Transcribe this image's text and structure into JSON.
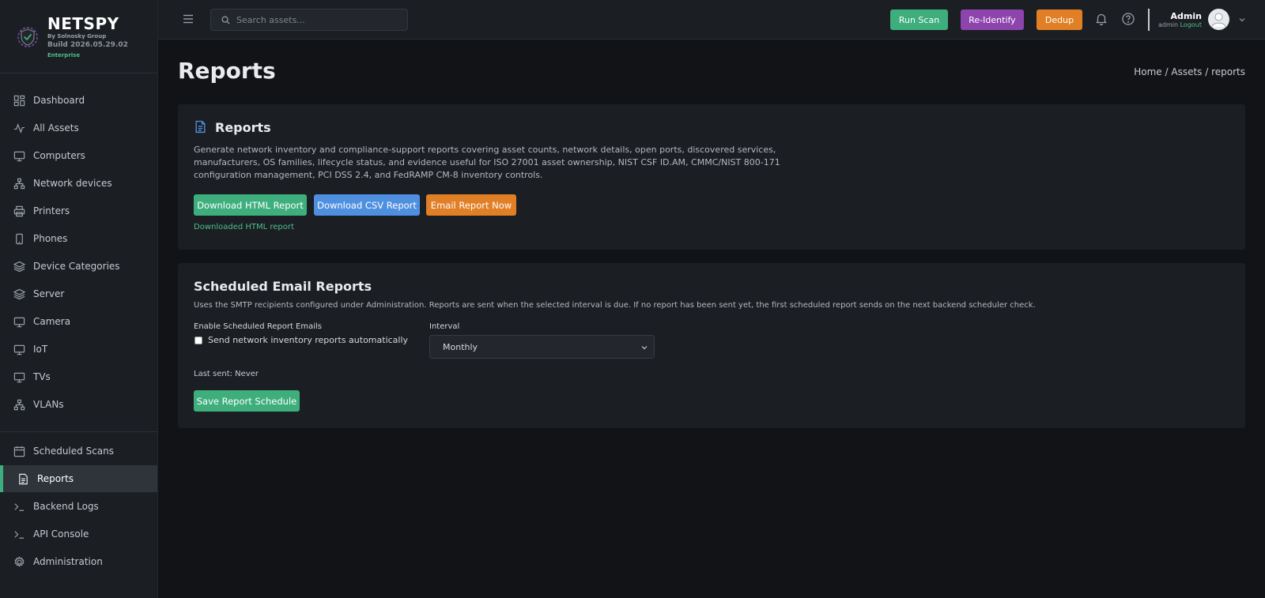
{
  "brand": {
    "name": "NETSPY",
    "by": "By Solnosky Group",
    "build": "Build 2026.05.29.02",
    "tier": "Enterprise"
  },
  "sidebar": {
    "items": [
      {
        "label": "Dashboard",
        "icon": "dashboard-icon"
      },
      {
        "label": "All Assets",
        "icon": "activity-icon"
      },
      {
        "label": "Computers",
        "icon": "monitor-icon"
      },
      {
        "label": "Network devices",
        "icon": "network-icon"
      },
      {
        "label": "Printers",
        "icon": "printer-icon"
      },
      {
        "label": "Phones",
        "icon": "phone-icon"
      },
      {
        "label": "Device Categories",
        "icon": "layers-icon"
      },
      {
        "label": "Server",
        "icon": "layers-icon"
      },
      {
        "label": "Camera",
        "icon": "monitor-icon"
      },
      {
        "label": "IoT",
        "icon": "monitor-icon"
      },
      {
        "label": "TVs",
        "icon": "monitor-icon"
      },
      {
        "label": "VLANs",
        "icon": "network-icon"
      }
    ],
    "tools": [
      {
        "label": "Scheduled Scans",
        "icon": "calendar-icon"
      },
      {
        "label": "Reports",
        "icon": "document-icon",
        "active": true
      },
      {
        "label": "Backend Logs",
        "icon": "terminal-icon"
      },
      {
        "label": "API Console",
        "icon": "terminal-icon"
      },
      {
        "label": "Administration",
        "icon": "gear-icon"
      }
    ]
  },
  "topbar": {
    "search_placeholder": "Search assets...",
    "run_scan": "Run Scan",
    "re_identify": "Re-Identify",
    "dedup": "Dedup",
    "user_name": "Admin",
    "user_role": "admin",
    "logout": "Logout"
  },
  "colors": {
    "accent_green": "#3fae7d",
    "purple": "#8e44ad",
    "orange": "#e07f25",
    "blue": "#4f8fe0"
  },
  "page": {
    "title": "Reports",
    "breadcrumb": [
      "Home",
      "Assets",
      "reports"
    ]
  },
  "reports_card": {
    "title": "Reports",
    "description_lines": [
      "Generate network inventory and compliance-support reports covering asset counts, network details, open ports, discovered services,",
      "manufacturers, OS families, lifecycle status, and evidence useful for ISO 27001 asset ownership, NIST CSF ID.AM, CMMC/NIST 800-171",
      "configuration management, PCI DSS 2.4, and FedRAMP CM-8 inventory controls."
    ],
    "download_html": "Download HTML Report",
    "download_csv": "Download CSV Report",
    "email_now": "Email Report Now",
    "status": "Downloaded HTML report"
  },
  "schedule_card": {
    "title": "Scheduled Email Reports",
    "description": "Uses the SMTP recipients configured under Administration. Reports are sent when the selected interval is due. If no report has been sent yet, the first scheduled report sends on the next backend scheduler check.",
    "enable_label": "Enable Scheduled Report Emails",
    "checkbox_label": "Send network inventory reports automatically",
    "checkbox_checked": false,
    "interval_label": "Interval",
    "interval_value": "Monthly",
    "last_sent": "Last sent: Never",
    "save": "Save Report Schedule"
  }
}
